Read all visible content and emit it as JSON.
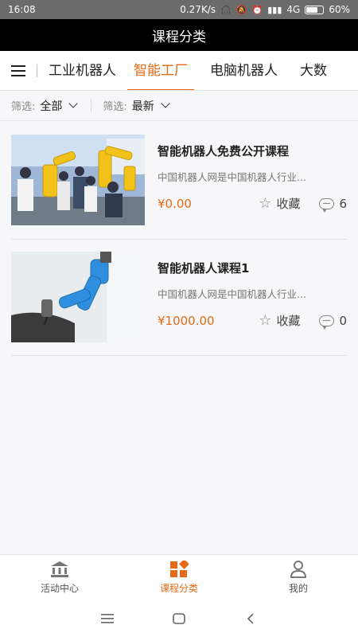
{
  "status_bar": {
    "time": "16:08",
    "net_speed": "0.27K/s",
    "network": "4G",
    "battery": "60%",
    "battery_level": 0.6
  },
  "header": {
    "title": "课程分类"
  },
  "tabs": {
    "menu_icon": "menu-icon",
    "items": [
      {
        "label": "工业机器人",
        "active": false
      },
      {
        "label": "智能工厂",
        "active": true
      },
      {
        "label": "电脑机器人",
        "active": false
      },
      {
        "label": "大数",
        "active": false
      }
    ]
  },
  "filters": [
    {
      "label": "筛选:",
      "value": "全部"
    },
    {
      "label": "筛选:",
      "value": "最新"
    }
  ],
  "courses": [
    {
      "title": "智能机器人免费公开课程",
      "description": "中国机器人网是中国机器人行业...",
      "price": "¥0.00",
      "favorite_label": "收藏",
      "comments": "6"
    },
    {
      "title": "智能机器人课程1",
      "description": "中国机器人网是中国机器人行业...",
      "price": "¥1000.00",
      "favorite_label": "收藏",
      "comments": "0"
    }
  ],
  "bottom_nav": [
    {
      "label": "活动中心",
      "icon": "bank-icon",
      "active": false
    },
    {
      "label": "课程分类",
      "icon": "category-icon",
      "active": true
    },
    {
      "label": "我的",
      "icon": "person-icon",
      "active": false
    }
  ],
  "colors": {
    "accent": "#e36a16",
    "header_bg": "#000000",
    "status_bg": "#6b6b6b"
  }
}
